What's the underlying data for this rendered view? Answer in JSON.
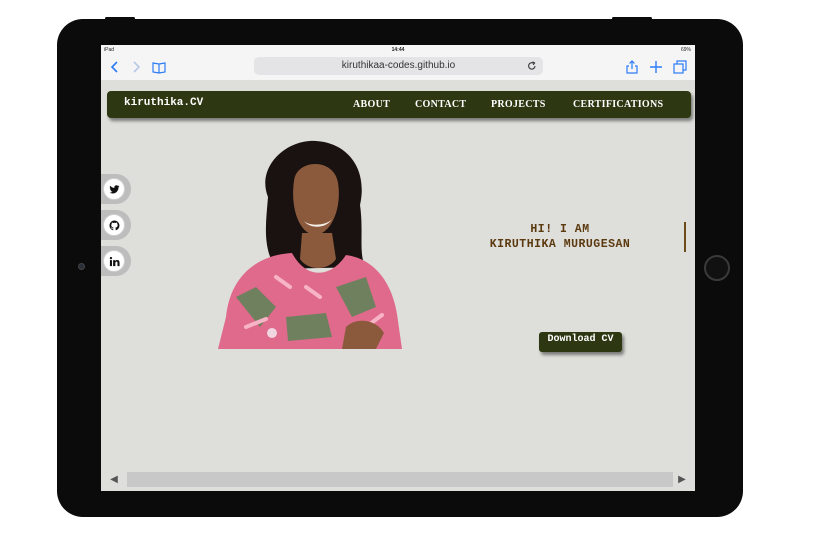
{
  "device": {
    "status_left": "iPad",
    "time": "14:44",
    "status_right": "69%"
  },
  "browser": {
    "url": "kiruthikaa-codes.github.io",
    "icons": {
      "back": "chevron-left-icon",
      "forward": "chevron-right-icon",
      "bookmarks": "book-icon",
      "reload": "reload-icon",
      "share": "share-icon",
      "new_tab": "plus-icon",
      "tabs": "tabs-icon"
    }
  },
  "site": {
    "logo": "kiruthika.CV",
    "nav": [
      "ABOUT",
      "CONTACT",
      "PROJECTS",
      "CERTIFICATIONS"
    ],
    "social": [
      "twitter-icon",
      "github-icon",
      "linkedin-icon"
    ],
    "hero_line1": "HI! I AM",
    "hero_line2": "KIRUTHIKA MURUGESAN",
    "download_label": "Download CV",
    "colors": {
      "nav_bg": "#2d3711",
      "page_bg": "#dededa",
      "hero_text": "#5c3a10",
      "browser_accent": "#2d7cf6"
    }
  },
  "scrollbar": {
    "left": "◀",
    "right": "▶"
  }
}
